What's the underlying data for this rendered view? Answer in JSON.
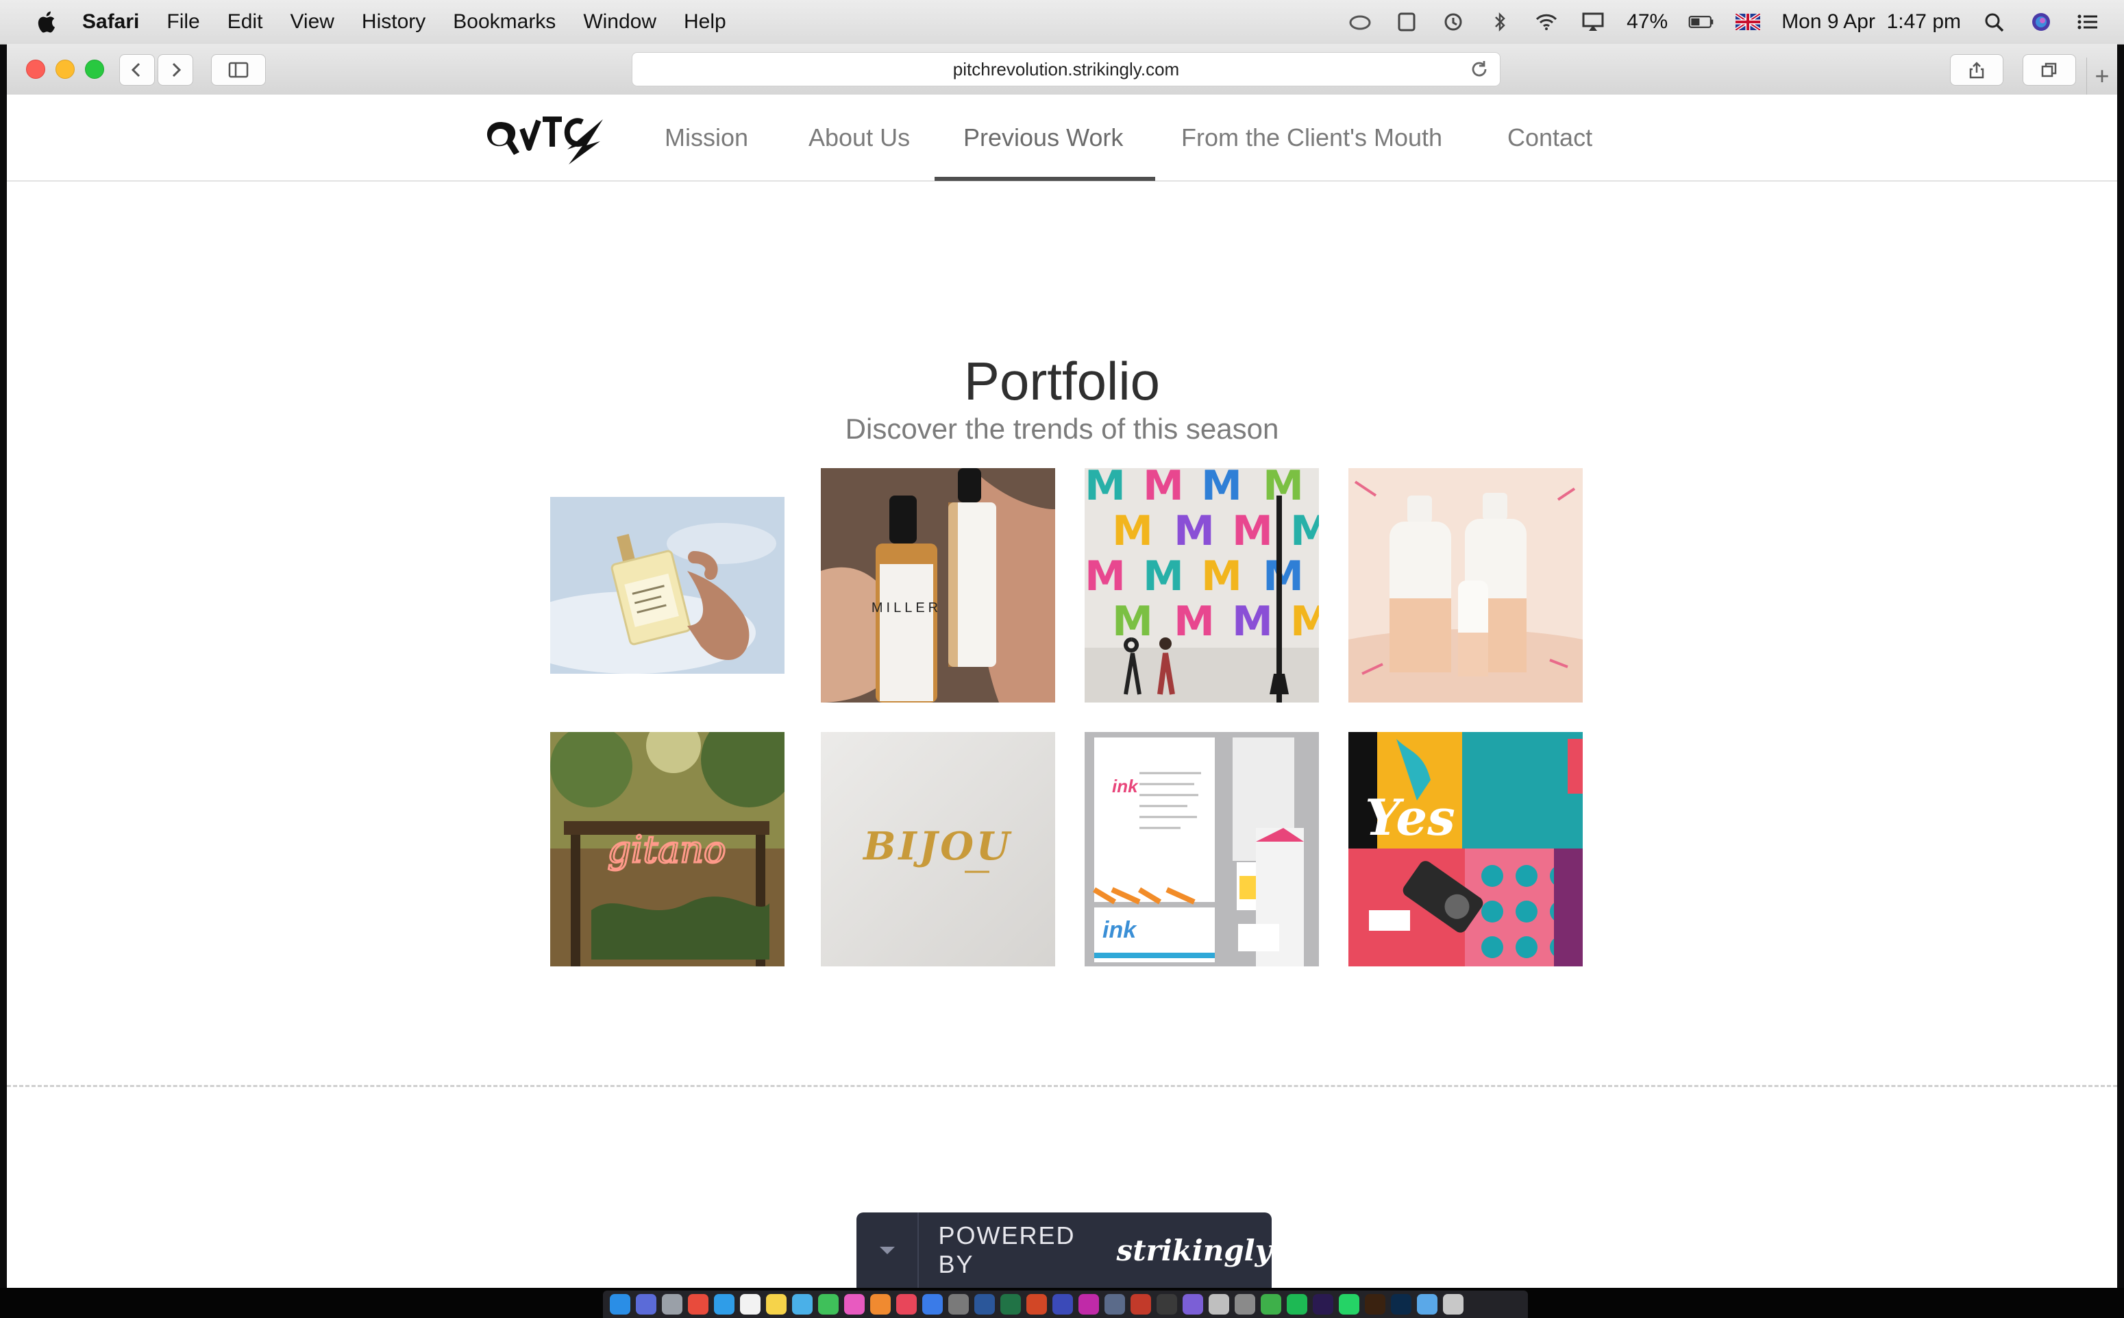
{
  "menubar": {
    "app_name": "Safari",
    "menus": [
      "File",
      "Edit",
      "View",
      "History",
      "Bookmarks",
      "Window",
      "Help"
    ],
    "battery": "47%",
    "datetime": "Mon 9 Apr  1:47 pm"
  },
  "browser": {
    "url": "pitchrevolution.strikingly.com"
  },
  "site": {
    "nav": [
      "Mission",
      "About Us",
      "Previous Work",
      "From the Client's Mouth",
      "Contact"
    ],
    "active_nav": "Previous Work",
    "title": "Portfolio",
    "subtitle": "Discover the trends of this season",
    "tiles": [
      {
        "icon": "serum-bottle-in-hand-photo"
      },
      {
        "icon": "dropper-bottles-photo",
        "label": "MILLER"
      },
      {
        "icon": "colorful-m-pattern-wall-photo"
      },
      {
        "icon": "shampoo-bottles-photo"
      },
      {
        "icon": "gitano-neon-sign-photo",
        "label": "gitano"
      },
      {
        "icon": "bijou-gold-logo-photo",
        "label": "BIJOU"
      },
      {
        "icon": "ink-stationery-photo",
        "label": "ink"
      },
      {
        "icon": "yes-poster-collage-photo",
        "label": "Yes"
      }
    ]
  },
  "powered": {
    "prefix": "POWERED BY",
    "brand": "strikingly"
  },
  "colors": {
    "accent_dark": "#2b2f3d",
    "nav_text": "#7a7a7a",
    "title_text": "#2f2f2f"
  }
}
